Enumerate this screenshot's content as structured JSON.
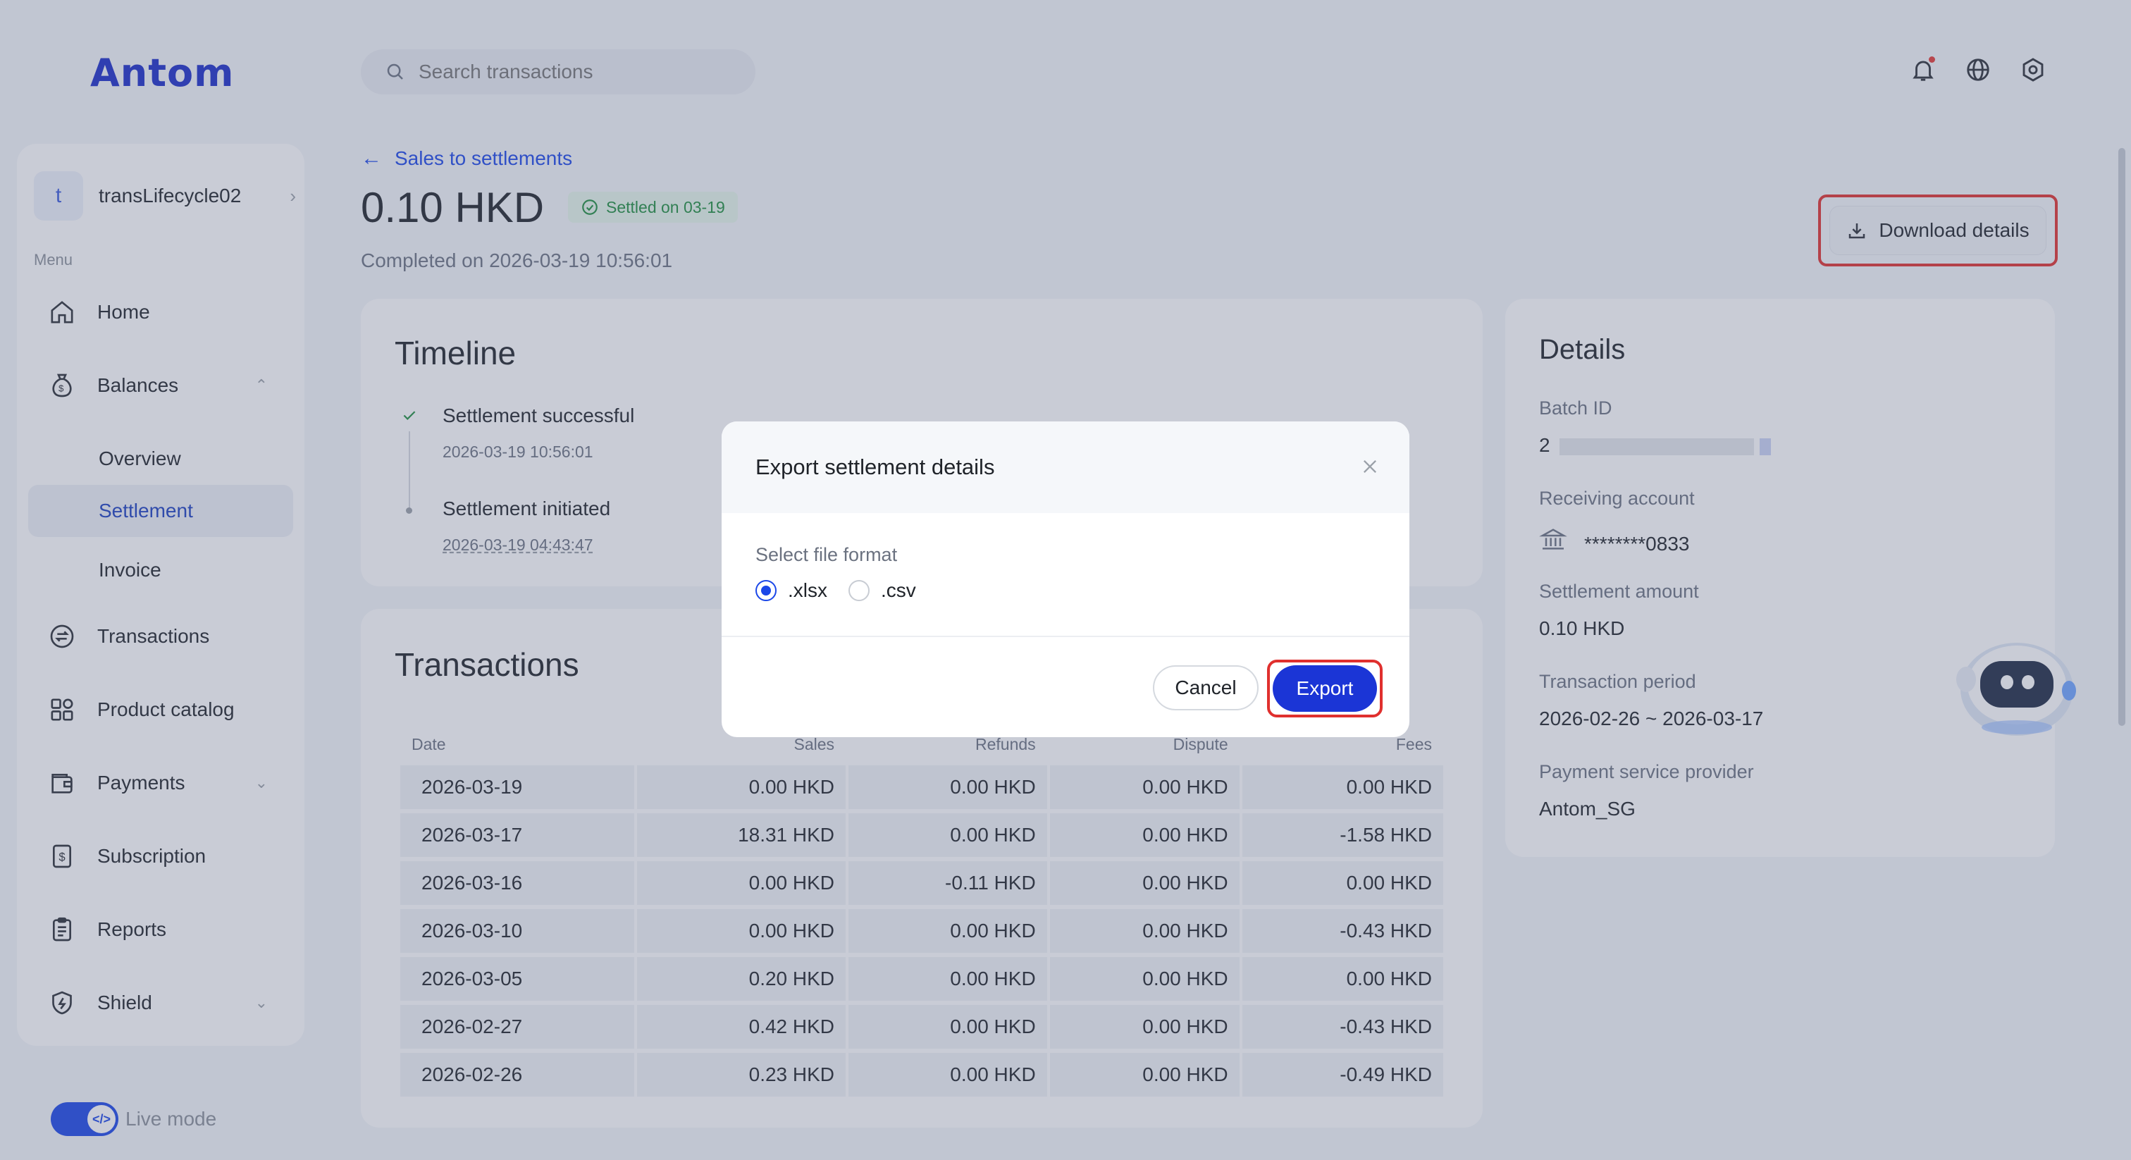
{
  "brand": {
    "logo": "Antom"
  },
  "search": {
    "placeholder": "Search transactions"
  },
  "sidebar": {
    "account_initial": "t",
    "account_name": "transLifecycle02",
    "menu_label": "Menu",
    "items": [
      {
        "label": "Home",
        "icon": "home-icon"
      },
      {
        "label": "Balances",
        "icon": "money-bag-icon"
      },
      {
        "label": "Overview"
      },
      {
        "label": "Settlement"
      },
      {
        "label": "Invoice"
      },
      {
        "label": "Transactions",
        "icon": "exchange-icon"
      },
      {
        "label": "Product catalog",
        "icon": "grid-icon"
      },
      {
        "label": "Payments",
        "icon": "wallet-icon"
      },
      {
        "label": "Subscription",
        "icon": "dollar-doc-icon"
      },
      {
        "label": "Reports",
        "icon": "clipboard-icon"
      },
      {
        "label": "Shield",
        "icon": "shield-icon"
      }
    ],
    "live_mode": "Live mode"
  },
  "header": {
    "back_link": "Sales to settlements",
    "amount": "0.10 HKD",
    "status_badge": "Settled on 03-19",
    "completed": "Completed on 2026-03-19 10:56:01",
    "download_button": "Download details"
  },
  "timeline": {
    "title": "Timeline",
    "events": [
      {
        "title": "Settlement successful",
        "time": "2026-03-19 10:56:01"
      },
      {
        "title": "Settlement initiated",
        "time": "2026-03-19 04:43:47"
      }
    ]
  },
  "transactions": {
    "title": "Transactions",
    "columns": [
      "Date",
      "Sales",
      "Refunds",
      "Dispute",
      "Fees"
    ],
    "rows": [
      [
        "2026-03-19",
        "0.00 HKD",
        "0.00 HKD",
        "0.00 HKD",
        "0.00 HKD"
      ],
      [
        "2026-03-17",
        "18.31 HKD",
        "0.00 HKD",
        "0.00 HKD",
        "-1.58 HKD"
      ],
      [
        "2026-03-16",
        "0.00 HKD",
        "-0.11 HKD",
        "0.00 HKD",
        "0.00 HKD"
      ],
      [
        "2026-03-10",
        "0.00 HKD",
        "0.00 HKD",
        "0.00 HKD",
        "-0.43 HKD"
      ],
      [
        "2026-03-05",
        "0.20 HKD",
        "0.00 HKD",
        "0.00 HKD",
        "0.00 HKD"
      ],
      [
        "2026-02-27",
        "0.42 HKD",
        "0.00 HKD",
        "0.00 HKD",
        "-0.43 HKD"
      ],
      [
        "2026-02-26",
        "0.23 HKD",
        "0.00 HKD",
        "0.00 HKD",
        "-0.49 HKD"
      ]
    ]
  },
  "details": {
    "title": "Details",
    "batch_id_label": "Batch ID",
    "batch_id_value": "2",
    "receiving_account_label": "Receiving account",
    "receiving_account_value": "********0833",
    "settlement_amount_label": "Settlement amount",
    "settlement_amount_value": "0.10 HKD",
    "transaction_period_label": "Transaction period",
    "transaction_period_value": "2026-02-26 ~ 2026-03-17",
    "psp_label": "Payment service provider",
    "psp_value": "Antom_SG"
  },
  "modal": {
    "title": "Export settlement details",
    "format_label": "Select file format",
    "options": [
      ".xlsx",
      ".csv"
    ],
    "selected": ".xlsx",
    "cancel": "Cancel",
    "export": "Export"
  },
  "colors": {
    "accent": "#1b47e8",
    "highlight": "#e0302e",
    "success": "#1e8e3e"
  }
}
